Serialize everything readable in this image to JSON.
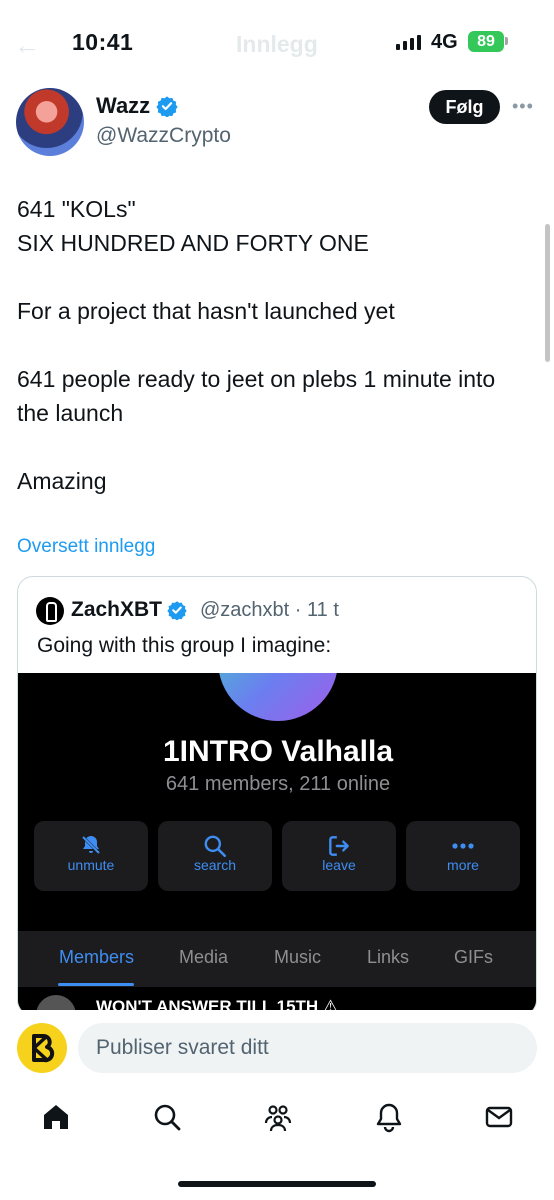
{
  "status_bar": {
    "time": "10:41",
    "network": "4G",
    "battery": "89",
    "ghost_title": "Innlegg"
  },
  "post": {
    "author_name": "Wazz",
    "author_handle": "@WazzCrypto",
    "follow_label": "Følg",
    "text": "641 \"KOLs\"\nSIX HUNDRED AND FORTY ONE\n\nFor a project that hasn't launched yet\n\n641 people ready to jeet on plebs 1 minute into the launch\n\nAmazing",
    "translate_label": "Oversett innlegg"
  },
  "quote": {
    "author_name": "ZachXBT",
    "meta": "@zachxbt · 11 t",
    "text": "Going with this group I imagine:",
    "image": {
      "group_title": "1INTRO Valhalla",
      "group_subtitle": "641 members, 211 online",
      "actions": [
        {
          "label": "unmute",
          "icon": "bell-slash-icon"
        },
        {
          "label": "search",
          "icon": "search-icon"
        },
        {
          "label": "leave",
          "icon": "leave-icon"
        },
        {
          "label": "more",
          "icon": "more-icon"
        }
      ],
      "tabs": [
        "Members",
        "Media",
        "Music",
        "Links",
        "GIFs"
      ],
      "active_tab": "Members",
      "partial_row_text": "WON'T ANSWER TILL 15TH ⚠"
    }
  },
  "reply": {
    "placeholder": "Publiser svaret ditt"
  },
  "colors": {
    "link": "#1d9bf0",
    "verified": "#1d9bf0",
    "telegram_accent": "#3e8df2",
    "battery": "#34c759"
  },
  "nav": [
    "home-icon",
    "search-icon",
    "communities-icon",
    "notifications-icon",
    "messages-icon"
  ]
}
